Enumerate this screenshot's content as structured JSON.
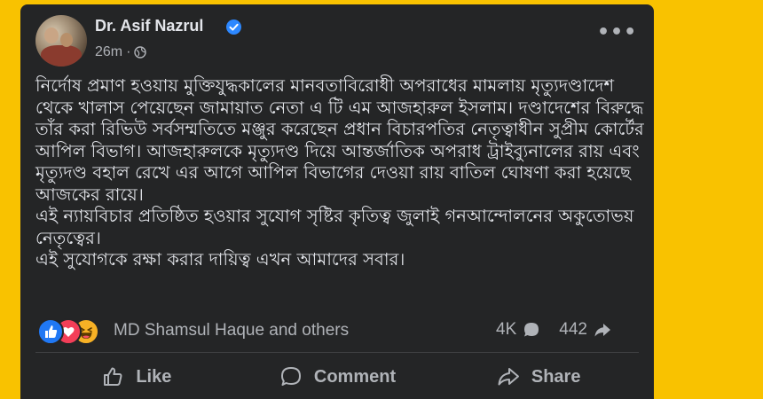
{
  "post": {
    "author": "Dr. Asif Nazrul",
    "time": "26m",
    "separator": "·",
    "more_label": "•••",
    "paragraphs": [
      "নির্দোষ প্রমাণ হওয়ায় মুক্তিযুদ্ধকালের মানবতাবিরোধী অপরাধের মামলায় মৃত্যুদণ্ডাদেশ থেকে খালাস পেয়েছেন জামায়াত নেতা এ টি এম আজহারুল ইসলাম। দণ্ডাদেশের বিরুদ্ধে তাঁর করা রিভিউ সর্বসম্মতিতে মঞ্জুর করেছেন প্রধান বিচারপতির নেতৃত্বাধীন সুপ্রীম কোর্টের আপিল বিভাগ। আজহারুলকে মৃত্যুদণ্ড দিয়ে আন্তর্জাতিক অপরাধ ট্রাইব্যুনালের রায় এবং মৃত্যুদণ্ড বহাল রেখে এর আগে আপিল বিভাগের দেওয়া রায় বাতিল ঘোষণা করা হয়েছে আজকের রায়ে।",
      "এই ন্যায়বিচার প্রতিষ্ঠিত হওয়ার সুযোগ সৃষ্টির কৃতিত্ব জুলাই গনআন্দোলনের অকুতোভয় নেতৃত্বের।",
      "এই সুযোগকে রক্ষা করার দায়িত্ব এখন আমাদের সবার।"
    ]
  },
  "reactions": {
    "names": "MD Shamsul Haque and others",
    "comments_count": "4K",
    "shares_count": "442"
  },
  "actions": {
    "like": "Like",
    "comment": "Comment",
    "share": "Share"
  }
}
